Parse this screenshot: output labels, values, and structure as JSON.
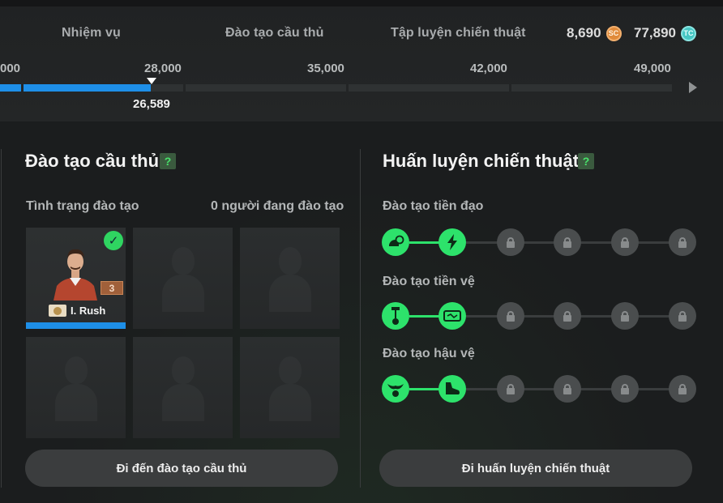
{
  "nav": {
    "tabs": [
      "Nhiệm vụ",
      "Đào tạo cầu thủ",
      "Tập luyện chiến thuật"
    ],
    "sc_amount": "8,690",
    "sc_label": "SC",
    "tc_amount": "77,890",
    "tc_label": "TC"
  },
  "progress": {
    "ticks": [
      "000",
      "28,000",
      "35,000",
      "42,000",
      "49,000"
    ],
    "current": "26,589",
    "fill_color": "#1e8fe8"
  },
  "player_training": {
    "title": "Đào tạo cầu thủ",
    "help": "?",
    "status_label": "Tình trạng đào tạo",
    "count_label": "0 người đang đào tạo",
    "player": {
      "name": "I. Rush",
      "rank": "3"
    },
    "button": "Đi đến đào tạo cầu thủ"
  },
  "tactics": {
    "title": "Huấn luyện chiến thuật",
    "help": "?",
    "rows": [
      {
        "label": "Đào tạo tiền đạo"
      },
      {
        "label": "Đào tạo tiền vệ"
      },
      {
        "label": "Đào tạo hậu vệ"
      }
    ],
    "button": "Đi huấn luyện chiến thuật",
    "accent": "#2de26b"
  }
}
